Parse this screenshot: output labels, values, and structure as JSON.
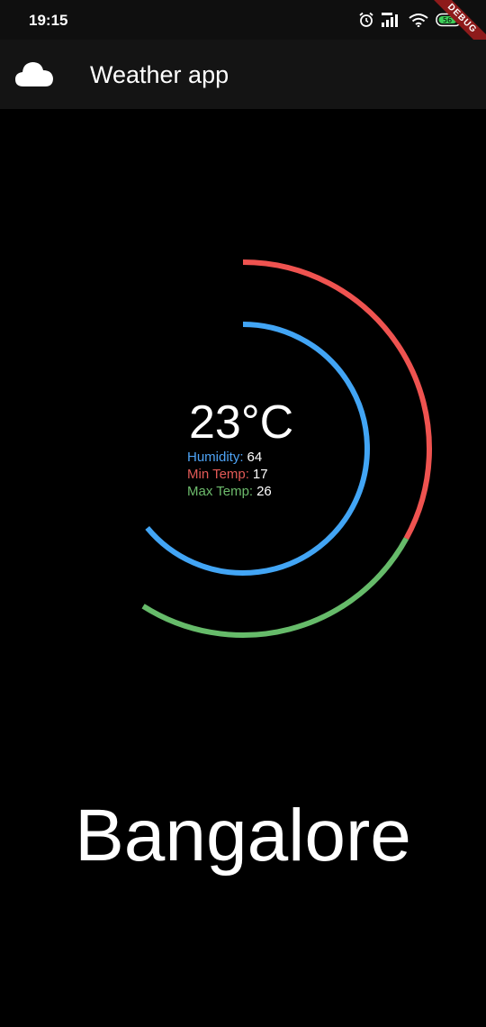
{
  "status_bar": {
    "time": "19:15",
    "icons": [
      "alarm-icon",
      "signal-icon",
      "wifi-icon",
      "battery-icon"
    ],
    "battery_level": "56",
    "debug_banner": "DEBUG"
  },
  "app_bar": {
    "icon": "cloud-icon",
    "title": "Weather app"
  },
  "weather": {
    "temperature": "23°C",
    "humidity_label": "Humidity:",
    "humidity": "64",
    "min_label": "Min Temp:",
    "min_temp": "17",
    "max_label": "Max Temp:",
    "max_temp": "26",
    "city": "Bangalore"
  },
  "gauge": {
    "humidity_fraction": 0.64,
    "min_temp_fraction": 0.17,
    "max_temp_fraction": 0.26
  },
  "colors": {
    "humidity": "#42a5f5",
    "min_temp": "#ef5350",
    "max_temp": "#66bb6a",
    "background": "#000000",
    "app_bar": "#141414"
  }
}
